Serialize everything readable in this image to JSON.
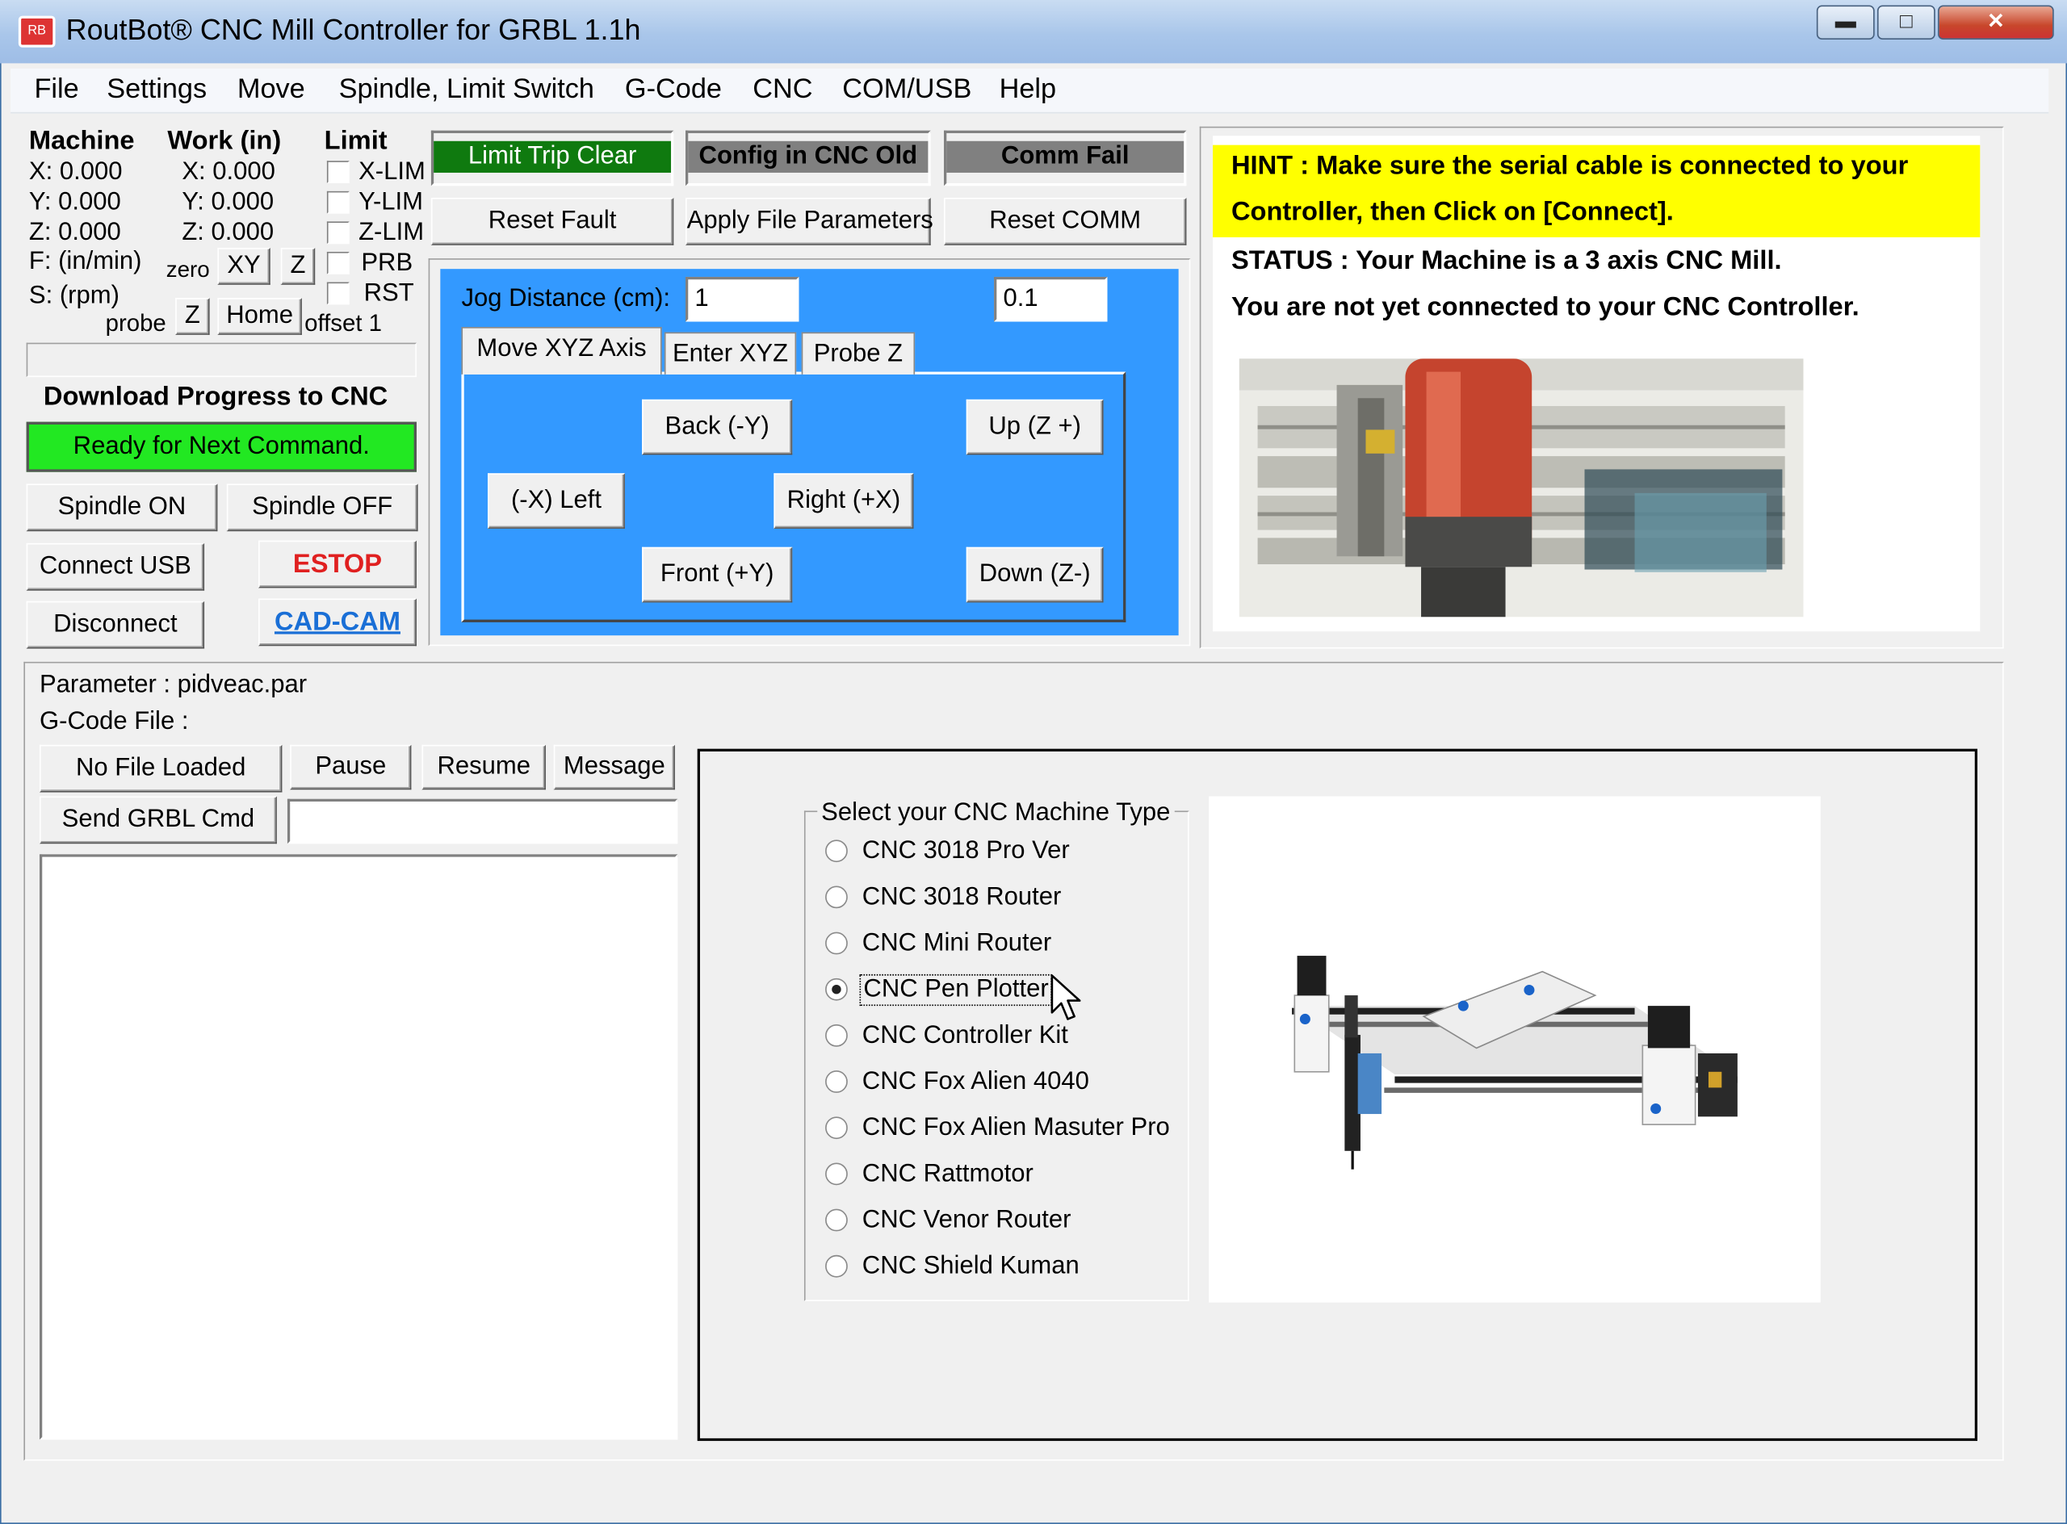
{
  "window": {
    "title": "RoutBot® CNC Mill Controller for GRBL 1.1h",
    "app_icon": "routbot-logo-icon",
    "app_icon_text": "RB",
    "controls": {
      "minimize": "▬",
      "maximize": "□",
      "close": "✕"
    }
  },
  "menu": [
    "File",
    "Settings",
    "Move",
    "Spindle, Limit Switch",
    "G-Code",
    "CNC",
    "COM/USB",
    "Help"
  ],
  "dro": {
    "machine_header": "Machine",
    "work_header": "Work (in)",
    "limit_header": "Limit",
    "machine": [
      "X: 0.000",
      "Y: 0.000",
      "Z: 0.000"
    ],
    "work": [
      "X: 0.000",
      "Y: 0.000",
      "Z: 0.000"
    ],
    "feed": "F: (in/min)",
    "speed": "S: (rpm)",
    "zero_label": "zero",
    "zero_xy": "XY",
    "zero_z": "Z",
    "probe_label": "probe",
    "probe_z": "Z",
    "home": "Home",
    "offset": "offset 1",
    "limits": [
      "X-LIM",
      "Y-LIM",
      "Z-LIM",
      "PRB",
      "RST"
    ]
  },
  "status_indicators": {
    "limit_trip": "Limit Trip Clear",
    "config": "Config in CNC Old",
    "comm": "Comm Fail"
  },
  "action_buttons": {
    "reset_fault": "Reset Fault",
    "apply_params": "Apply File Parameters",
    "reset_comm": "Reset COMM"
  },
  "download": {
    "title": "Download Progress to CNC",
    "status": "Ready for Next Command."
  },
  "spindle": {
    "on": "Spindle ON",
    "off": "Spindle OFF"
  },
  "connection": {
    "connect": "Connect USB",
    "disconnect": "Disconnect",
    "estop": "ESTOP",
    "cadcam": "CAD-CAM"
  },
  "jog": {
    "label": "Jog Distance (cm):",
    "distance": "1",
    "step": "0.1",
    "tabs": [
      "Move XYZ Axis",
      "Enter XYZ",
      "Probe Z"
    ],
    "back": "Back  (-Y)",
    "up": "Up (Z +)",
    "left": "(-X) Left",
    "right": "Right  (+X)",
    "front": "Front  (+Y)",
    "down": "Down (Z-)"
  },
  "hint": {
    "line1": "HINT    : Make sure the serial cable is connected to your",
    "line2": "Controller, then Click on [Connect].",
    "status1": "STATUS : Your Machine is a 3 axis CNC Mill.",
    "status2": "You are not yet connected to your CNC Controller."
  },
  "file": {
    "parameter": "Parameter : pidveac.par",
    "gcode": "G-Code File :",
    "no_file": "No File Loaded",
    "pause": "Pause",
    "resume": "Resume",
    "message": "Message",
    "send": "Send GRBL Cmd",
    "cmd_value": ""
  },
  "machine_type": {
    "title": "Select your CNC Machine Type",
    "options": [
      "CNC 3018 Pro Ver",
      "CNC 3018 Router",
      "CNC Mini Router",
      "CNC Pen Plotter",
      "CNC Controller Kit",
      "CNC Fox Alien 4040",
      "CNC Fox Alien Masuter Pro",
      "CNC Rattmotor",
      "CNC Venor Router",
      "CNC Shield Kuman"
    ],
    "selected": "CNC Pen Plotter"
  },
  "colors": {
    "green_indicator": "#0f7a0f",
    "ready_green": "#22e822",
    "hint_yellow": "#ffff00",
    "jog_blue": "#3399ff",
    "estop_red": "#e02020",
    "cadcam_blue": "#1a6fd6"
  }
}
